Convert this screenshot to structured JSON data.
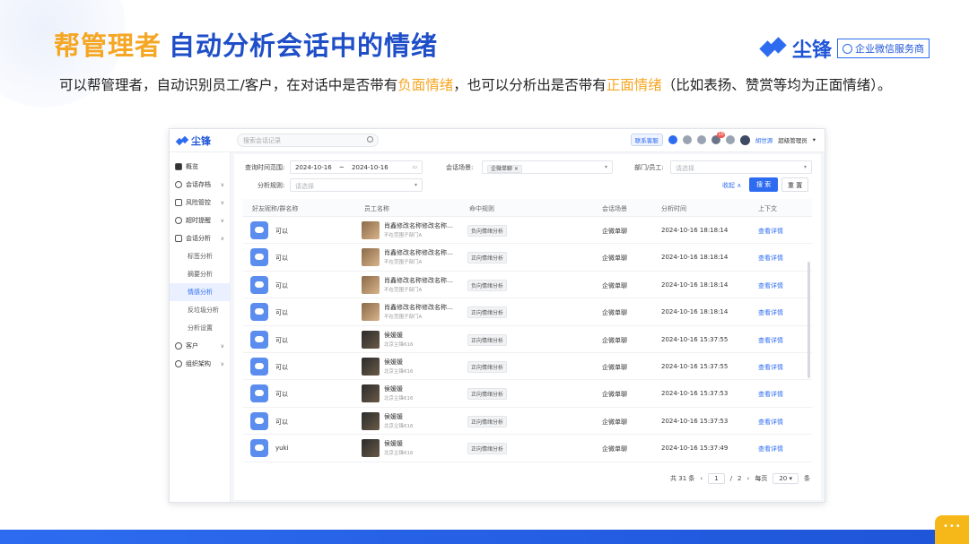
{
  "slide": {
    "title_a": "帮管理者",
    "title_b": "自动分析会话中的情绪",
    "brand_name": "尘锋",
    "brand_tag": "企业微信服务商",
    "intro_1": "可以帮管理者，自动识别员工/客户，在对话中是否带有",
    "intro_hl1": "负面情绪",
    "intro_2": "，也可以分析出是否带有",
    "intro_hl2": "正面情绪",
    "intro_3": "（比如表扬、赞赏等均为正面情绪）。"
  },
  "app": {
    "logo": "尘锋",
    "search_placeholder": "搜索会话记录",
    "topbar": {
      "contact_btn": "联系客服",
      "notif_count": "10",
      "user_name": "胡世源",
      "role": "超级管理员"
    },
    "sidebar": {
      "items": [
        {
          "label": "概览"
        },
        {
          "label": "会话存档"
        },
        {
          "label": "风险管控"
        },
        {
          "label": "超时提醒"
        },
        {
          "label": "会话分析"
        }
      ],
      "subitems": [
        {
          "label": "标签分析"
        },
        {
          "label": "摘要分析"
        },
        {
          "label": "情感分析"
        },
        {
          "label": "反垃圾分析"
        },
        {
          "label": "分析设置"
        }
      ],
      "items_bottom": [
        {
          "label": "客户"
        },
        {
          "label": "组织架构"
        }
      ]
    },
    "filters": {
      "time_label": "查询时间范围:",
      "date_from": "2024-10-16",
      "date_sep": "~",
      "date_to": "2024-10-16",
      "scene_label": "会话场景:",
      "scene_value": "企微单聊",
      "dept_label": "部门/员工:",
      "dept_placeholder": "请选择",
      "rule_label": "分析规则:",
      "rule_placeholder": "请选择",
      "collapse": "收起",
      "search_btn": "搜 索",
      "reset_btn": "重 置"
    },
    "table": {
      "headers": [
        "好友昵称/群名称",
        "员工名称",
        "命中规则",
        "会话场景",
        "分析时间",
        "上下文"
      ],
      "rows": [
        {
          "friend": "可以",
          "emp": "肖鑫修改名称修改名称…",
          "dept": "不在范围子部门A",
          "rule": "负向情绪分析",
          "scene": "企微单聊",
          "time": "2024-10-16 18:18:14",
          "ctx": "查看详情",
          "dark": false
        },
        {
          "friend": "可以",
          "emp": "肖鑫修改名称修改名称…",
          "dept": "不在范围子部门A",
          "rule": "正向情绪分析",
          "scene": "企微单聊",
          "time": "2024-10-16 18:18:14",
          "ctx": "查看详情",
          "dark": false
        },
        {
          "friend": "可以",
          "emp": "肖鑫修改名称修改名称…",
          "dept": "不在范围子部门A",
          "rule": "负向情绪分析",
          "scene": "企微单聊",
          "time": "2024-10-16 18:18:14",
          "ctx": "查看详情",
          "dark": false
        },
        {
          "friend": "可以",
          "emp": "肖鑫修改名称修改名称…",
          "dept": "不在范围子部门A",
          "rule": "正向情绪分析",
          "scene": "企微单聊",
          "time": "2024-10-16 18:18:14",
          "ctx": "查看详情",
          "dark": false
        },
        {
          "friend": "可以",
          "emp": "侯媛媛",
          "dept": "北京尘锋616",
          "rule": "正向情绪分析",
          "scene": "企微单聊",
          "time": "2024-10-16 15:37:55",
          "ctx": "查看详情",
          "dark": true
        },
        {
          "friend": "可以",
          "emp": "侯媛媛",
          "dept": "北京尘锋616",
          "rule": "正向情绪分析",
          "scene": "企微单聊",
          "time": "2024-10-16 15:37:55",
          "ctx": "查看详情",
          "dark": true
        },
        {
          "friend": "可以",
          "emp": "侯媛媛",
          "dept": "北京尘锋616",
          "rule": "正向情绪分析",
          "scene": "企微单聊",
          "time": "2024-10-16 15:37:53",
          "ctx": "查看详情",
          "dark": true
        },
        {
          "friend": "可以",
          "emp": "侯媛媛",
          "dept": "北京尘锋616",
          "rule": "正向情绪分析",
          "scene": "企微单聊",
          "time": "2024-10-16 15:37:53",
          "ctx": "查看详情",
          "dark": true
        },
        {
          "friend": "yuki",
          "emp": "侯媛媛",
          "dept": "北京尘锋616",
          "rule": "正向情绪分析",
          "scene": "企微单聊",
          "time": "2024-10-16 15:37:49",
          "ctx": "查看详情",
          "dark": true
        }
      ]
    },
    "pager": {
      "total": "共 31 条",
      "page": "1",
      "sep": "/",
      "pages": "2",
      "per_page_label": "每页",
      "per_page": "20",
      "unit": "条"
    }
  }
}
